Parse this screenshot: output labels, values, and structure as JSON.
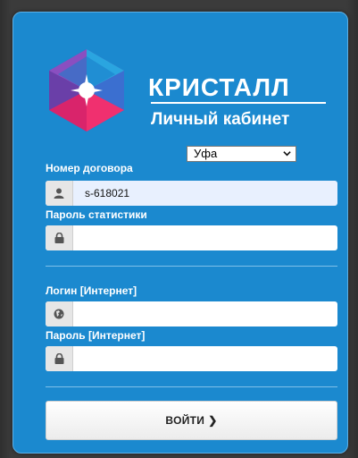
{
  "brand": {
    "title": "КРИСТАЛЛ",
    "subtitle": "Личный кабинет",
    "logo_icon": "crystal-logo-icon"
  },
  "city_select": {
    "selected": "Уфа"
  },
  "fields": {
    "contract": {
      "label": "Номер договора",
      "value": "s-618021",
      "icon": "user-icon"
    },
    "stat_password": {
      "label": "Пароль статистики",
      "value": "",
      "icon": "lock-icon"
    },
    "internet_login": {
      "label": "Логин [Интернет]",
      "value": "",
      "icon": "globe-icon"
    },
    "internet_password": {
      "label": "Пароль [Интернет]",
      "value": "",
      "icon": "lock-icon"
    }
  },
  "login_button": {
    "label": "ВОЙТИ",
    "arrow": "❯"
  },
  "colors": {
    "panel": "#1b89cf",
    "accent_pink": "#e8175d",
    "accent_purple": "#7b4fb5"
  }
}
